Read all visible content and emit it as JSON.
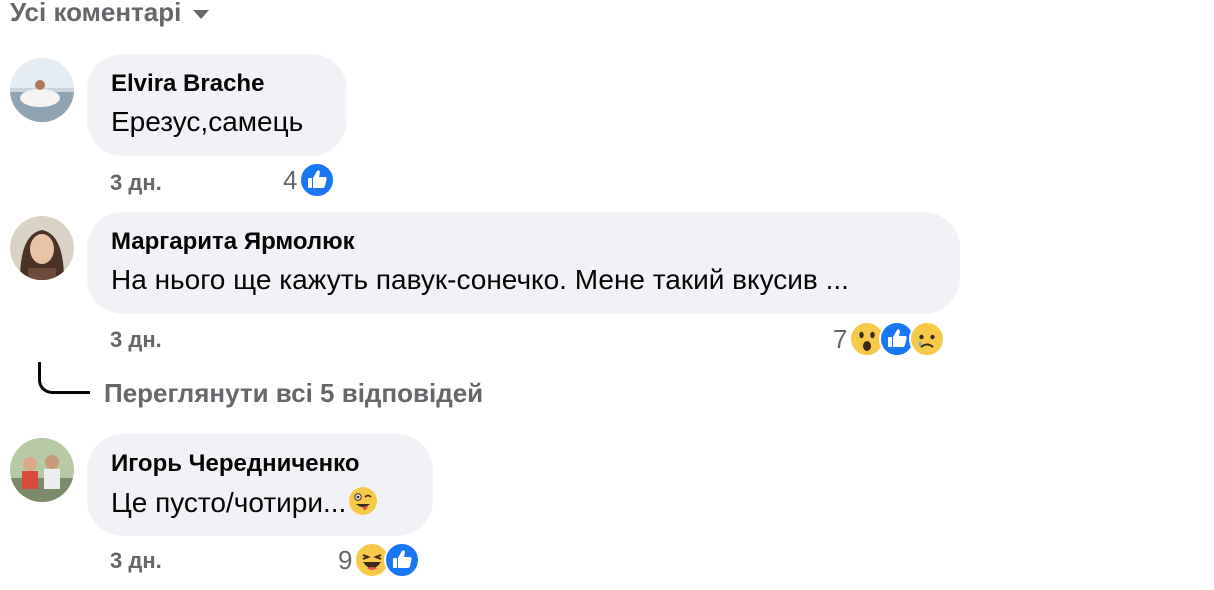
{
  "filter": {
    "label": "Усі коментарі",
    "icon": "caret-down-icon"
  },
  "colors": {
    "bubble": "#f0f2f5",
    "secondary_text": "#65676b",
    "like_blue": "#1877f2",
    "emoji_yellow": "#f7c948"
  },
  "comments": [
    {
      "author": "Elvira Brache",
      "text": "Ерезус,самець",
      "time": "3 дн.",
      "reaction_count": "4",
      "reactions": [
        "like-icon"
      ]
    },
    {
      "author": "Маргарита Ярмолюк",
      "text": "На нього ще кажуть павук-сонечко. Мене такий вкусив ...",
      "time": "3 дн.",
      "reaction_count": "7",
      "reactions": [
        "wow-icon",
        "like-icon",
        "sad-icon"
      ],
      "replies_link": "Переглянути всі 5 відповідей"
    },
    {
      "author": "Игорь Чередниченко",
      "text": "Це пусто/чотири...",
      "text_emoji": "zany-face-icon",
      "time": "3 дн.",
      "reaction_count": "9",
      "reactions": [
        "haha-icon",
        "like-icon"
      ]
    }
  ]
}
